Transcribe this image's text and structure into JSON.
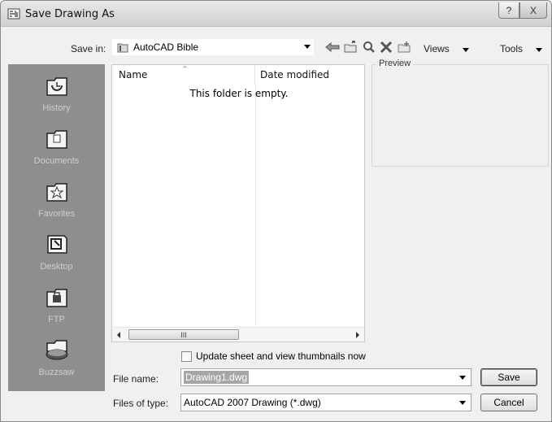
{
  "window": {
    "title": "Save Drawing As"
  },
  "titlebar": {
    "help_glyph": "?",
    "close_glyph": "X"
  },
  "toolbar": {
    "save_in_label": "Save in:",
    "save_in_value": "AutoCAD Bible",
    "views_label": "Views",
    "tools_label": "Tools"
  },
  "places": [
    {
      "label": "History",
      "icon": "history-icon"
    },
    {
      "label": "Documents",
      "icon": "documents-icon"
    },
    {
      "label": "Favorites",
      "icon": "favorites-icon"
    },
    {
      "label": "Desktop",
      "icon": "desktop-icon"
    },
    {
      "label": "FTP",
      "icon": "ftp-icon"
    },
    {
      "label": "Buzzsaw",
      "icon": "buzzsaw-icon"
    }
  ],
  "filelist": {
    "columns": [
      "Name",
      "Date modified"
    ],
    "empty_message": "This folder is empty.",
    "scroll_grip": "III"
  },
  "preview": {
    "label": "Preview"
  },
  "options": {
    "update_thumbnails_label": "Update sheet and view thumbnails now",
    "update_thumbnails_checked": false
  },
  "form": {
    "file_name_label": "File name:",
    "file_name_value": "Drawing1.dwg",
    "file_type_label": "Files of type:",
    "file_type_value": "AutoCAD 2007 Drawing (*.dwg)"
  },
  "buttons": {
    "save": "Save",
    "cancel": "Cancel"
  },
  "colors": {
    "places_bg": "#8e8e8e",
    "dialog_bg": "#f0f0f0",
    "selection_bg": "#a6a6a6"
  }
}
